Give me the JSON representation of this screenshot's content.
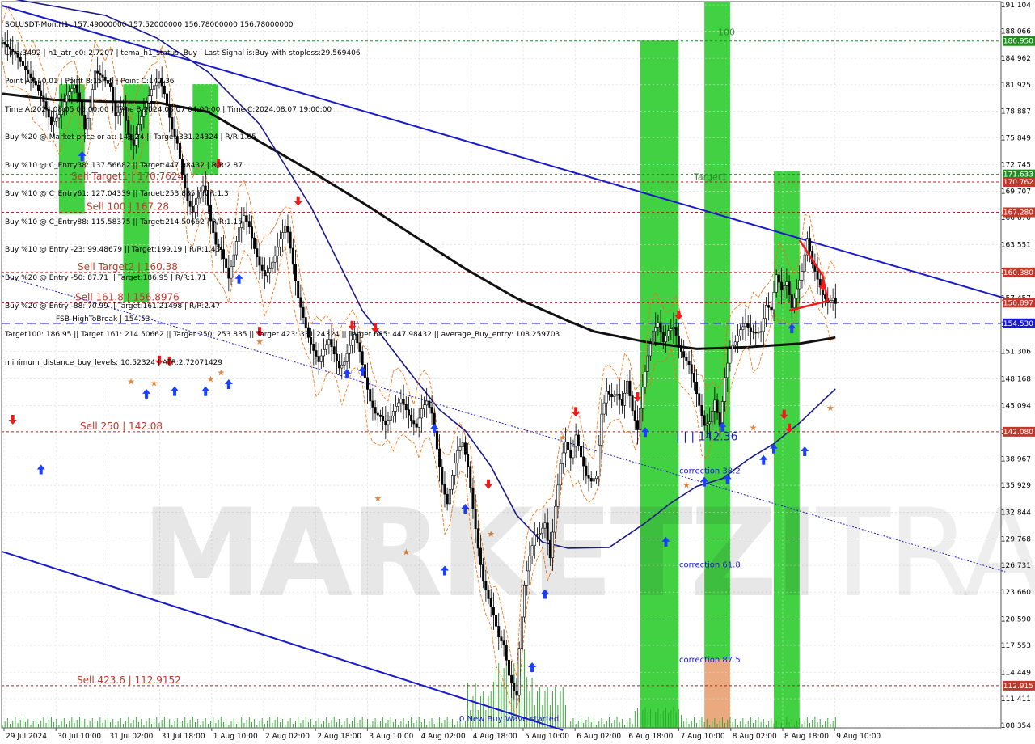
{
  "colors": {
    "background": "#ffffff",
    "grid": "#d8d8d8",
    "green_zone": "#32cd32",
    "orange_zone": "#e8a070",
    "sell_level_line": "#b22222",
    "sell_level_text": "#c0392b",
    "buy_level_line": "#228b22",
    "blue_channel": "#1a1acd",
    "ma_black": "#111111",
    "ma_blue": "#1a1a8c",
    "price_line": "#ff6a00",
    "up_arrow": "#1a3fff",
    "down_arrow": "#ee1c1c",
    "star": "#e08840",
    "axis_text": "#000000"
  },
  "info_panel": [
    "SOLUSDT-Mon,H1  157.49000000 157.52000000 156.78000000 156.78000000",
    "Line:3492 | h1_atr_c0: 2.7207 | tema_h1_status: Buy | Last Signal is:Buy with stoploss:29.569406",
    "Point A:110.01 | Point B:154.6 | Point C:142.36",
    "Time A:2024.08.05 06:00:00 | Time B:2024.08.07 04:00:00 | Time C:2024.08.07 19:00:00",
    "Buy %20 @ Market price or at: 143.24 || Target:331.24324 | R/R:1.65",
    "Buy %10 @ C_Entry38: 137.56682 || Target:447.98432 | R/R:2.87",
    "Buy %10 @ C_Entry61: 127.04339 || Target:253.835 | R/R:1.3",
    "Buy %10 @ C_Entry88: 115.58375 || Target:214.50662 | R/R:1.15",
    "Buy %10 @ Entry -23: 99.48679 || Target:199.19 | R/R:1.43",
    "Buy %20 @ Entry -50: 87.71 || Target:186.95 | R/R:1.71",
    "Buy %20 @ Entry -88: 70.99 || Target:161.21498 | R/R:2.47",
    "Target100: 186.95 || Target 161: 214.50662 || Target 250: 253.835 || Target 423: 331.24324 || Target 685: 447.98432 || average_Buy_entry: 108.259703",
    "minimum_distance_buy_levels: 10.52324 | ATR:2.72071429"
  ],
  "watermark": {
    "main": "MARKETZI",
    "light": "TRADE"
  },
  "chart_data": {
    "type": "candlestick",
    "symbol": "SOLUSDT",
    "timeframe": "H1",
    "ylim": [
      107.0,
      191.5
    ],
    "x_labels": [
      "29 Jul 2024",
      "30 Jul 10:00",
      "31 Jul 02:00",
      "31 Jul 18:00",
      "1 Aug 10:00",
      "2 Aug 02:00",
      "2 Aug 18:00",
      "3 Aug 10:00",
      "4 Aug 02:00",
      "4 Aug 18:00",
      "5 Aug 10:00",
      "6 Aug 02:00",
      "6 Aug 18:00",
      "7 Aug 10:00",
      "8 Aug 02:00",
      "8 Aug 18:00",
      "9 Aug 10:00"
    ],
    "y_ticks": [
      191.104,
      188.066,
      184.962,
      181.925,
      178.887,
      175.849,
      172.745,
      169.707,
      166.67,
      163.551,
      160.495,
      157.457,
      154.42,
      151.306,
      148.168,
      145.094,
      142.056,
      138.967,
      135.929,
      132.844,
      129.768,
      126.731,
      123.66,
      120.59,
      117.553,
      114.449,
      111.411,
      108.354
    ],
    "price_badges": [
      {
        "value": "186.950",
        "color": "#228b22"
      },
      {
        "value": "171.633",
        "color": "#228b22"
      },
      {
        "value": "170.762",
        "color": "#c0392b"
      },
      {
        "value": "167.280",
        "color": "#c0392b"
      },
      {
        "value": "160.380",
        "color": "#c0392b"
      },
      {
        "value": "156.897",
        "color": "#c0392b"
      },
      {
        "value": "154.530",
        "color": "#1a1acd"
      },
      {
        "value": "142.080",
        "color": "#c0392b"
      },
      {
        "value": "112.915",
        "color": "#c0392b"
      }
    ],
    "levels": [
      {
        "label": "Sell Target1 | 170.7624",
        "value": 170.7624,
        "kind": "sell"
      },
      {
        "label": "Sell 100 | 167.28",
        "value": 167.28,
        "kind": "sell"
      },
      {
        "label": "Sell Target2 | 160.38",
        "value": 160.38,
        "kind": "sell"
      },
      {
        "label": "Sell 161.8 | 156.8976",
        "value": 156.8976,
        "kind": "sell"
      },
      {
        "label": "FSB-HighToBreak | 154.53",
        "value": 154.53,
        "kind": "fsb"
      },
      {
        "label": "Sell 250 | 142.08",
        "value": 142.08,
        "kind": "sell"
      },
      {
        "label": "Sell 423.6 | 112.9152",
        "value": 112.9152,
        "kind": "sell"
      },
      {
        "label": "",
        "value": 186.95,
        "kind": "buy"
      },
      {
        "label": "",
        "value": 171.633,
        "kind": "buy"
      }
    ],
    "annotations": [
      {
        "text": "100",
        "price": 187.6
      },
      {
        "text": "Target1",
        "price": 171.0
      },
      {
        "text": "| | | 142.36",
        "price": 141.1
      },
      {
        "text": "correction 38.2",
        "price": 137.3
      },
      {
        "text": "correction 61.8",
        "price": 126.5
      },
      {
        "text": "correction 87.5",
        "price": 115.6
      },
      {
        "text": "0 New Buy Wave started",
        "price": 108.8
      }
    ],
    "close_path": [
      [
        0,
        186.8
      ],
      [
        5,
        185.5
      ],
      [
        10,
        183.2
      ],
      [
        13,
        181.9
      ],
      [
        16,
        180.0
      ],
      [
        19,
        177.3
      ],
      [
        22,
        178.5
      ],
      [
        25,
        180.7
      ],
      [
        28,
        181.9
      ],
      [
        30,
        180.1
      ],
      [
        32,
        176.8
      ],
      [
        34,
        179.3
      ],
      [
        36,
        183.5
      ],
      [
        39,
        182.8
      ],
      [
        42,
        181.7
      ],
      [
        44,
        178.4
      ],
      [
        47,
        179.4
      ],
      [
        49,
        176.2
      ],
      [
        51,
        175.0
      ],
      [
        53,
        177.4
      ],
      [
        55,
        179.1
      ],
      [
        58,
        181.4
      ],
      [
        61,
        182.7
      ],
      [
        63,
        180.9
      ],
      [
        66,
        176.8
      ],
      [
        68,
        175.2
      ],
      [
        70,
        171.6
      ],
      [
        72,
        168.6
      ],
      [
        74,
        167.3
      ],
      [
        76,
        168.9
      ],
      [
        78,
        170.3
      ],
      [
        79,
        169.8
      ],
      [
        81,
        166.3
      ],
      [
        83,
        163.6
      ],
      [
        85,
        163.0
      ],
      [
        87,
        160.9
      ],
      [
        88,
        159.7
      ],
      [
        90,
        162.4
      ],
      [
        92,
        165.5
      ],
      [
        94,
        166.9
      ],
      [
        96,
        165.6
      ],
      [
        98,
        163.1
      ],
      [
        100,
        161.2
      ],
      [
        102,
        160.0
      ],
      [
        104,
        160.8
      ],
      [
        106,
        162.3
      ],
      [
        108,
        164.2
      ],
      [
        110,
        165.7
      ],
      [
        111,
        165.0
      ],
      [
        113,
        161.3
      ],
      [
        115,
        157.5
      ],
      [
        117,
        155.2
      ],
      [
        119,
        152.9
      ],
      [
        121,
        151.4
      ],
      [
        123,
        150.1
      ],
      [
        125,
        151.5
      ],
      [
        127,
        152.7
      ],
      [
        129,
        151.0
      ],
      [
        131,
        149.4
      ],
      [
        133,
        150.1
      ],
      [
        135,
        152.0
      ],
      [
        137,
        153.3
      ],
      [
        139,
        151.3
      ],
      [
        141,
        148.3
      ],
      [
        143,
        145.6
      ],
      [
        145,
        144.2
      ],
      [
        147,
        143.8
      ],
      [
        149,
        142.9
      ],
      [
        151,
        143.9
      ],
      [
        153,
        145.0
      ],
      [
        155,
        145.8
      ],
      [
        157,
        144.6
      ],
      [
        159,
        143.4
      ],
      [
        161,
        142.6
      ],
      [
        163,
        144.7
      ],
      [
        165,
        145.6
      ],
      [
        167,
        144.2
      ],
      [
        169,
        140.1
      ],
      [
        171,
        136.0
      ],
      [
        173,
        133.8
      ],
      [
        175,
        137.1
      ],
      [
        177,
        139.9
      ],
      [
        179,
        140.8
      ],
      [
        181,
        138.1
      ],
      [
        183,
        133.2
      ],
      [
        185,
        128.7
      ],
      [
        187,
        124.9
      ],
      [
        189,
        122.9
      ],
      [
        191,
        121.0
      ],
      [
        193,
        118.5
      ],
      [
        195,
        117.6
      ],
      [
        197,
        114.1
      ],
      [
        199,
        112.3
      ],
      [
        200,
        111.8
      ],
      [
        201,
        117.2
      ],
      [
        203,
        124.4
      ],
      [
        205,
        127.8
      ],
      [
        207,
        130.2
      ],
      [
        209,
        130.4
      ],
      [
        211,
        131.6
      ],
      [
        213,
        127.6
      ],
      [
        215,
        133.5
      ],
      [
        217,
        138.4
      ],
      [
        219,
        140.9
      ],
      [
        221,
        139.1
      ],
      [
        223,
        141.7
      ],
      [
        225,
        139.2
      ],
      [
        227,
        137.1
      ],
      [
        229,
        136.4
      ],
      [
        231,
        137.0
      ],
      [
        233,
        144.1
      ],
      [
        235,
        146.7
      ],
      [
        237,
        146.1
      ],
      [
        239,
        146.4
      ],
      [
        241,
        145.1
      ],
      [
        243,
        147.9
      ],
      [
        245,
        144.5
      ],
      [
        247,
        142.3
      ],
      [
        249,
        147.2
      ],
      [
        251,
        150.8
      ],
      [
        253,
        153.6
      ],
      [
        255,
        154.6
      ],
      [
        257,
        152.4
      ],
      [
        259,
        153.7
      ],
      [
        261,
        154.1
      ],
      [
        263,
        152.0
      ],
      [
        265,
        150.6
      ],
      [
        267,
        149.8
      ],
      [
        269,
        147.8
      ],
      [
        271,
        145.1
      ],
      [
        273,
        142.8
      ],
      [
        275,
        143.2
      ],
      [
        277,
        145.7
      ],
      [
        279,
        142.8
      ],
      [
        281,
        148.3
      ],
      [
        283,
        151.6
      ],
      [
        285,
        152.4
      ],
      [
        287,
        153.8
      ],
      [
        289,
        154.5
      ],
      [
        291,
        153.6
      ],
      [
        293,
        153.4
      ],
      [
        295,
        153.6
      ],
      [
        297,
        156.6
      ],
      [
        299,
        156.1
      ],
      [
        301,
        160.1
      ],
      [
        303,
        158.4
      ],
      [
        305,
        159.3
      ],
      [
        307,
        156.3
      ],
      [
        309,
        158.5
      ],
      [
        311,
        160.5
      ],
      [
        313,
        164.3
      ],
      [
        315,
        161.4
      ],
      [
        317,
        159.6
      ],
      [
        319,
        157.8
      ],
      [
        321,
        156.9
      ],
      [
        323,
        157.4
      ],
      [
        324,
        156.8
      ]
    ],
    "series": [
      {
        "name": "",
        "type": "ma",
        "color": "#111111",
        "points": [
          [
            0,
            180.9
          ],
          [
            20,
            180.2
          ],
          [
            40,
            180.0
          ],
          [
            60,
            179.9
          ],
          [
            80,
            178.8
          ],
          [
            100,
            175.4
          ],
          [
            120,
            172.0
          ],
          [
            140,
            168.4
          ],
          [
            160,
            164.6
          ],
          [
            180,
            160.8
          ],
          [
            200,
            157.4
          ],
          [
            220,
            154.8
          ],
          [
            230,
            153.6
          ],
          [
            250,
            152.4
          ],
          [
            270,
            151.6
          ],
          [
            280,
            151.7
          ],
          [
            290,
            151.8
          ],
          [
            300,
            152.0
          ],
          [
            310,
            152.2
          ],
          [
            324,
            152.9
          ]
        ]
      },
      {
        "name": "",
        "type": "ma",
        "color": "#1a1a8c",
        "points": [
          [
            0,
            192.0
          ],
          [
            40,
            189.9
          ],
          [
            60,
            187.3
          ],
          [
            80,
            183.4
          ],
          [
            100,
            177.4
          ],
          [
            120,
            167.9
          ],
          [
            140,
            156.0
          ],
          [
            160,
            148.3
          ],
          [
            170,
            144.6
          ],
          [
            180,
            142.2
          ],
          [
            190,
            138.1
          ],
          [
            200,
            132.5
          ],
          [
            210,
            129.4
          ],
          [
            220,
            128.7
          ],
          [
            236,
            128.8
          ],
          [
            250,
            131.6
          ],
          [
            260,
            133.9
          ],
          [
            270,
            135.8
          ],
          [
            280,
            136.7
          ],
          [
            290,
            138.9
          ],
          [
            300,
            140.7
          ],
          [
            310,
            143.1
          ],
          [
            324,
            147.0
          ]
        ]
      }
    ],
    "zones": [
      {
        "from_bar": 22,
        "to_bar": 32,
        "top": 182.0,
        "bottom": 167.1,
        "color": "green"
      },
      {
        "from_bar": 47,
        "to_bar": 57,
        "top": 182.0,
        "bottom": 157.0,
        "color": "green"
      },
      {
        "from_bar": 74,
        "to_bar": 84,
        "top": 182.0,
        "bottom": 171.6,
        "color": "green"
      },
      {
        "from_bar": 248,
        "to_bar": 263,
        "top": 187.0,
        "bottom": 108.0,
        "color": "green"
      },
      {
        "from_bar": 273,
        "to_bar": 283,
        "top": 191.5,
        "bottom": 115.9,
        "color": "green"
      },
      {
        "from_bar": 273,
        "to_bar": 283,
        "top": 115.9,
        "bottom": 108.0,
        "color": "orange"
      },
      {
        "from_bar": 300,
        "to_bar": 310,
        "top": 172.0,
        "bottom": 108.0,
        "color": "green"
      }
    ],
    "trendlines": [
      {
        "points": [
          [
            0,
            191.0
          ],
          [
            390,
            157.4
          ]
        ],
        "style": "solid",
        "color": "#1a1acd"
      },
      {
        "points": [
          [
            0,
            160.0
          ],
          [
            390,
            126.0
          ]
        ],
        "style": "dotted",
        "color": "#1a1acd"
      },
      {
        "points": [
          [
            0,
            128.3
          ],
          [
            218,
            107.8
          ]
        ],
        "style": "solid",
        "color": "#1a1acd"
      }
    ],
    "triangle": {
      "color": "#ee1c1c",
      "points": [
        [
          310,
          164.1
        ],
        [
          319,
          160.0
        ],
        [
          321,
          157.1
        ],
        [
          306,
          156.0
        ]
      ]
    },
    "arrows_up": [
      [
        15,
        138.3
      ],
      [
        31,
        174.3
      ],
      [
        56,
        147.0
      ],
      [
        67,
        147.3
      ],
      [
        79,
        147.3
      ],
      [
        88,
        148.1
      ],
      [
        92,
        160.2
      ],
      [
        134,
        149.3
      ],
      [
        140,
        149.6
      ],
      [
        168,
        143.0
      ],
      [
        180,
        133.8
      ],
      [
        172,
        126.7
      ],
      [
        211,
        124.0
      ],
      [
        206,
        115.6
      ],
      [
        250,
        142.6
      ],
      [
        258,
        130.0
      ],
      [
        273,
        136.9
      ],
      [
        280,
        143.2
      ],
      [
        282,
        137.2
      ],
      [
        296,
        139.4
      ],
      [
        300,
        140.7
      ],
      [
        307,
        154.5
      ],
      [
        312,
        140.4
      ]
    ],
    "arrows_down": [
      [
        4,
        142.9
      ],
      [
        61,
        149.7
      ],
      [
        65,
        149.6
      ],
      [
        84,
        172.3
      ],
      [
        100,
        153.0
      ],
      [
        115,
        168.0
      ],
      [
        136,
        153.7
      ],
      [
        145,
        153.4
      ],
      [
        189,
        135.5
      ],
      [
        223,
        143.8
      ],
      [
        247,
        145.5
      ],
      [
        263,
        154.9
      ],
      [
        304,
        143.5
      ],
      [
        306,
        141.9
      ],
      [
        319,
        158.3
      ]
    ],
    "stars": [
      [
        50,
        147.5
      ],
      [
        59,
        147.3
      ],
      [
        81,
        147.8
      ],
      [
        85,
        148.5
      ],
      [
        100,
        152.1
      ],
      [
        146,
        134.1
      ],
      [
        157,
        127.9
      ],
      [
        218,
        141.1
      ],
      [
        292,
        142.2
      ],
      [
        322,
        144.5
      ],
      [
        266,
        135.6
      ],
      [
        190,
        130.0
      ]
    ]
  }
}
